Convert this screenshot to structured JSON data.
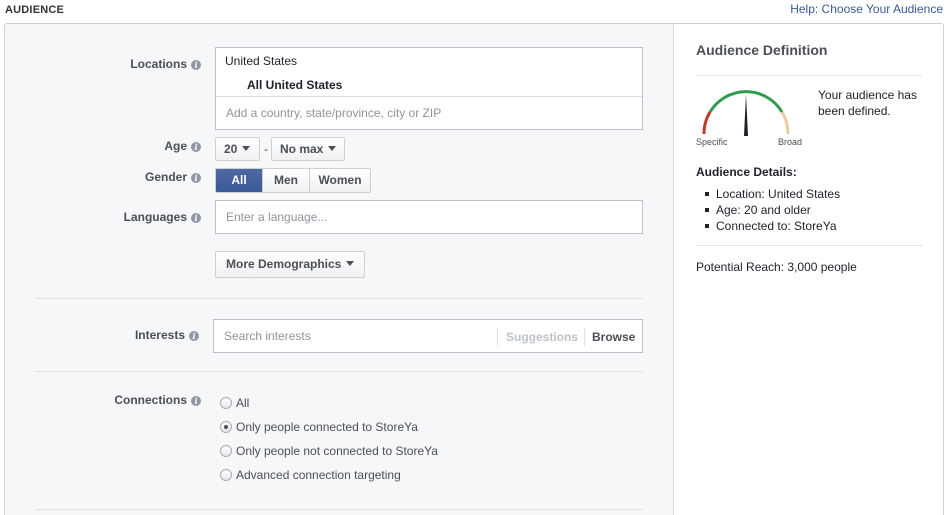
{
  "header": {
    "section_title": "AUDIENCE",
    "help_link": "Help: Choose Your Audience"
  },
  "form": {
    "locations": {
      "label": "Locations",
      "country": "United States",
      "selection": "All United States",
      "placeholder": "Add a country, state/province, city or ZIP"
    },
    "age": {
      "label": "Age",
      "min_value": "20",
      "separator": "-",
      "max_value": "No max"
    },
    "gender": {
      "label": "Gender",
      "options": [
        "All",
        "Men",
        "Women"
      ],
      "selected": "All"
    },
    "languages": {
      "label": "Languages",
      "placeholder": "Enter a language..."
    },
    "more_demographics": "More Demographics",
    "interests": {
      "label": "Interests",
      "placeholder": "Search interests",
      "suggestions": "Suggestions",
      "browse": "Browse"
    },
    "connections": {
      "label": "Connections",
      "options": [
        "All",
        "Only people connected to StoreYa",
        "Only people not connected to StoreYa",
        "Advanced connection targeting"
      ],
      "selected_index": 1
    }
  },
  "sidebar": {
    "title": "Audience Definition",
    "gauge": {
      "specific_label": "Specific",
      "broad_label": "Broad",
      "message": "Your audience has been defined.",
      "colors": {
        "specific": "#c0392b",
        "mid": "#2e9b4e",
        "broad": "#f0c9a0"
      }
    },
    "details_title": "Audience Details:",
    "details": [
      "Location: United States",
      "Age: 20 and older",
      "Connected to: StoreYa"
    ],
    "potential_reach": "Potential Reach: 3,000 people"
  },
  "colors": {
    "accent": "#3b5998",
    "link": "#3b5998"
  }
}
